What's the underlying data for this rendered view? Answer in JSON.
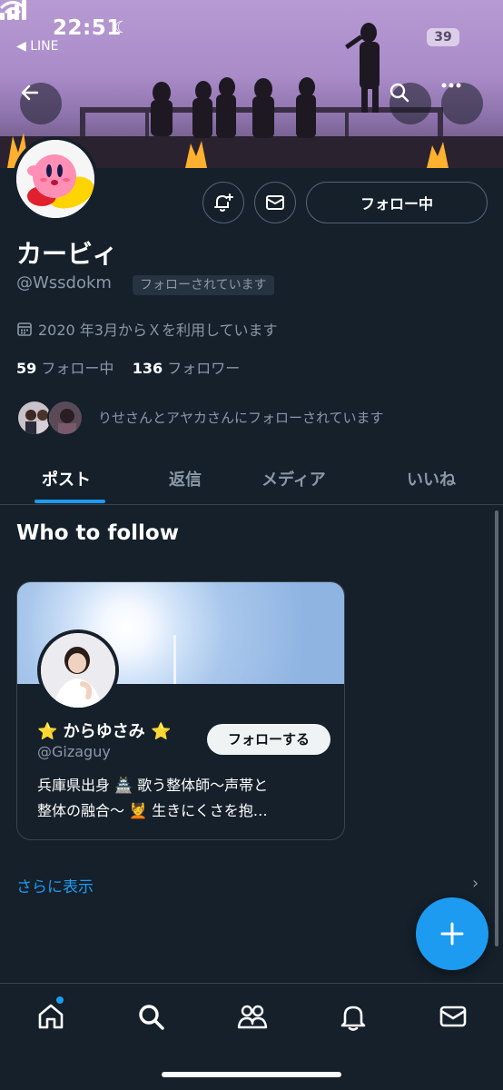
{
  "status_bar": {
    "time": "22:51",
    "back_app": "◀ LINE",
    "battery": "39"
  },
  "profile": {
    "name": "カービィ",
    "handle": "@Wssdokm",
    "follows_you": "フォローされています",
    "joined": "2020 年3月からＸを利用しています",
    "following_count": "59",
    "following_label": "フォロー中",
    "followers_count": "136",
    "followers_label": "フォロワー",
    "mutuals_text": "りせさんとアヤカさんにフォローされています",
    "following_button": "フォロー中"
  },
  "tabs": [
    {
      "label": "ポスト"
    },
    {
      "label": "返信"
    },
    {
      "label": "メディア"
    },
    {
      "label": "いいね"
    }
  ],
  "who_to_follow": {
    "title": "Who to follow",
    "card": {
      "name": "⭐ からゆさみ ⭐",
      "handle": "@Gizaguy",
      "follow_button": "フォローする",
      "bio_line1": "兵庫県出身 🏯 歌う整体師〜声帯と",
      "bio_line2": "整体の融合〜 💆 生きにくさを抱…"
    },
    "show_more": "さらに表示"
  },
  "colors": {
    "background": "#15202b",
    "accent": "#1d9bf0",
    "muted_text": "#8b98a5",
    "border": "#38444d"
  },
  "icons": [
    "back-arrow-icon",
    "search-icon",
    "more-icon",
    "notification-add-icon",
    "mail-icon",
    "calendar-icon",
    "plus-icon",
    "home-icon",
    "communities-icon",
    "bell-icon"
  ]
}
